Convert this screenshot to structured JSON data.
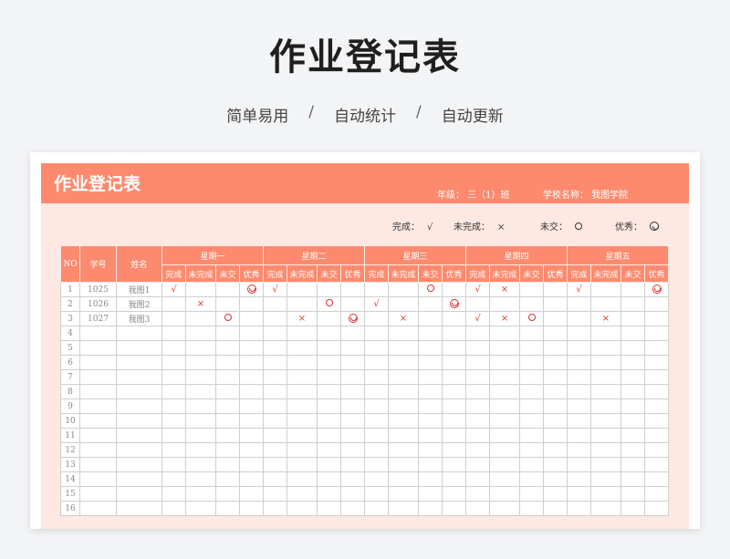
{
  "main_title": "作业登记表",
  "subtitle": [
    "简单易用",
    "自动统计",
    "自动更新"
  ],
  "subtitle_sep": "/",
  "sheet": {
    "title": "作业登记表",
    "grade_label": "年级：",
    "grade_value": "三（1）班",
    "school_label": "学校名称：",
    "school_value": "我图学院"
  },
  "legend": [
    {
      "label": "完成：",
      "symbol": "check",
      "text": "√"
    },
    {
      "label": "未完成：",
      "symbol": "cross",
      "text": "×"
    },
    {
      "label": "未交：",
      "symbol": "circle",
      "text": "○"
    },
    {
      "label": "优秀：",
      "symbol": "smile",
      "text": ""
    }
  ],
  "colors": {
    "accent": "#fd8a6e",
    "panel": "#fde8e2",
    "mark": "#e03030"
  },
  "table": {
    "col_no": "NO",
    "col_id": "学号",
    "col_name": "姓名",
    "days": [
      "星期一",
      "星期二",
      "星期三",
      "星期四",
      "星期五"
    ],
    "statuses": [
      "完成",
      "未完成",
      "未交",
      "优秀"
    ],
    "rows": [
      {
        "no": "1",
        "id": "1025",
        "name": "我图1",
        "marks": [
          "check",
          "",
          "",
          "smile",
          "check",
          "",
          "",
          "",
          "",
          "",
          "circle",
          "",
          "check",
          "cross",
          "",
          "",
          "check",
          "",
          "",
          "smile"
        ]
      },
      {
        "no": "2",
        "id": "1026",
        "name": "我图2",
        "marks": [
          "",
          "cross",
          "",
          "",
          "",
          "",
          "circle",
          "",
          "check",
          "",
          "",
          "smile",
          "",
          "",
          "",
          "",
          "",
          "",
          "",
          ""
        ]
      },
      {
        "no": "3",
        "id": "1027",
        "name": "我图3",
        "marks": [
          "",
          "",
          "circle",
          "",
          "",
          "cross",
          "",
          "smile",
          "",
          "cross",
          "",
          "",
          "check",
          "cross",
          "circle",
          "",
          "",
          "cross",
          "",
          ""
        ]
      },
      {
        "no": "4",
        "id": "",
        "name": "",
        "marks": []
      },
      {
        "no": "5",
        "id": "",
        "name": "",
        "marks": []
      },
      {
        "no": "6",
        "id": "",
        "name": "",
        "marks": []
      },
      {
        "no": "7",
        "id": "",
        "name": "",
        "marks": []
      },
      {
        "no": "8",
        "id": "",
        "name": "",
        "marks": []
      },
      {
        "no": "9",
        "id": "",
        "name": "",
        "marks": []
      },
      {
        "no": "10",
        "id": "",
        "name": "",
        "marks": []
      },
      {
        "no": "11",
        "id": "",
        "name": "",
        "marks": []
      },
      {
        "no": "12",
        "id": "",
        "name": "",
        "marks": []
      },
      {
        "no": "13",
        "id": "",
        "name": "",
        "marks": []
      },
      {
        "no": "14",
        "id": "",
        "name": "",
        "marks": []
      },
      {
        "no": "15",
        "id": "",
        "name": "",
        "marks": []
      },
      {
        "no": "16",
        "id": "",
        "name": "",
        "marks": []
      }
    ]
  }
}
